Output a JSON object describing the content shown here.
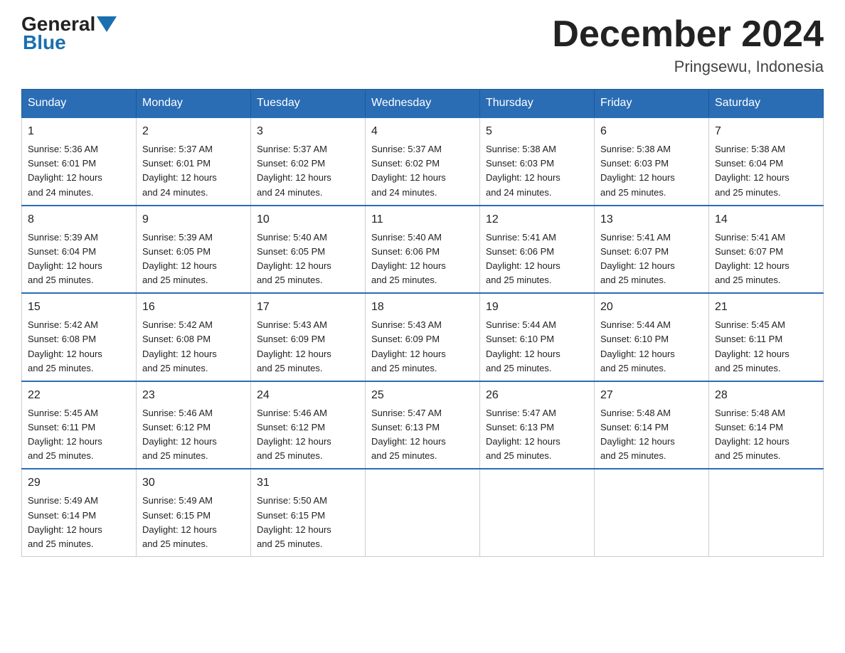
{
  "logo": {
    "general": "General",
    "blue": "Blue"
  },
  "title": {
    "month": "December 2024",
    "location": "Pringsewu, Indonesia"
  },
  "header": {
    "days": [
      "Sunday",
      "Monday",
      "Tuesday",
      "Wednesday",
      "Thursday",
      "Friday",
      "Saturday"
    ]
  },
  "weeks": [
    [
      {
        "day": "1",
        "sunrise": "5:36 AM",
        "sunset": "6:01 PM",
        "daylight": "12 hours and 24 minutes."
      },
      {
        "day": "2",
        "sunrise": "5:37 AM",
        "sunset": "6:01 PM",
        "daylight": "12 hours and 24 minutes."
      },
      {
        "day": "3",
        "sunrise": "5:37 AM",
        "sunset": "6:02 PM",
        "daylight": "12 hours and 24 minutes."
      },
      {
        "day": "4",
        "sunrise": "5:37 AM",
        "sunset": "6:02 PM",
        "daylight": "12 hours and 24 minutes."
      },
      {
        "day": "5",
        "sunrise": "5:38 AM",
        "sunset": "6:03 PM",
        "daylight": "12 hours and 24 minutes."
      },
      {
        "day": "6",
        "sunrise": "5:38 AM",
        "sunset": "6:03 PM",
        "daylight": "12 hours and 25 minutes."
      },
      {
        "day": "7",
        "sunrise": "5:38 AM",
        "sunset": "6:04 PM",
        "daylight": "12 hours and 25 minutes."
      }
    ],
    [
      {
        "day": "8",
        "sunrise": "5:39 AM",
        "sunset": "6:04 PM",
        "daylight": "12 hours and 25 minutes."
      },
      {
        "day": "9",
        "sunrise": "5:39 AM",
        "sunset": "6:05 PM",
        "daylight": "12 hours and 25 minutes."
      },
      {
        "day": "10",
        "sunrise": "5:40 AM",
        "sunset": "6:05 PM",
        "daylight": "12 hours and 25 minutes."
      },
      {
        "day": "11",
        "sunrise": "5:40 AM",
        "sunset": "6:06 PM",
        "daylight": "12 hours and 25 minutes."
      },
      {
        "day": "12",
        "sunrise": "5:41 AM",
        "sunset": "6:06 PM",
        "daylight": "12 hours and 25 minutes."
      },
      {
        "day": "13",
        "sunrise": "5:41 AM",
        "sunset": "6:07 PM",
        "daylight": "12 hours and 25 minutes."
      },
      {
        "day": "14",
        "sunrise": "5:41 AM",
        "sunset": "6:07 PM",
        "daylight": "12 hours and 25 minutes."
      }
    ],
    [
      {
        "day": "15",
        "sunrise": "5:42 AM",
        "sunset": "6:08 PM",
        "daylight": "12 hours and 25 minutes."
      },
      {
        "day": "16",
        "sunrise": "5:42 AM",
        "sunset": "6:08 PM",
        "daylight": "12 hours and 25 minutes."
      },
      {
        "day": "17",
        "sunrise": "5:43 AM",
        "sunset": "6:09 PM",
        "daylight": "12 hours and 25 minutes."
      },
      {
        "day": "18",
        "sunrise": "5:43 AM",
        "sunset": "6:09 PM",
        "daylight": "12 hours and 25 minutes."
      },
      {
        "day": "19",
        "sunrise": "5:44 AM",
        "sunset": "6:10 PM",
        "daylight": "12 hours and 25 minutes."
      },
      {
        "day": "20",
        "sunrise": "5:44 AM",
        "sunset": "6:10 PM",
        "daylight": "12 hours and 25 minutes."
      },
      {
        "day": "21",
        "sunrise": "5:45 AM",
        "sunset": "6:11 PM",
        "daylight": "12 hours and 25 minutes."
      }
    ],
    [
      {
        "day": "22",
        "sunrise": "5:45 AM",
        "sunset": "6:11 PM",
        "daylight": "12 hours and 25 minutes."
      },
      {
        "day": "23",
        "sunrise": "5:46 AM",
        "sunset": "6:12 PM",
        "daylight": "12 hours and 25 minutes."
      },
      {
        "day": "24",
        "sunrise": "5:46 AM",
        "sunset": "6:12 PM",
        "daylight": "12 hours and 25 minutes."
      },
      {
        "day": "25",
        "sunrise": "5:47 AM",
        "sunset": "6:13 PM",
        "daylight": "12 hours and 25 minutes."
      },
      {
        "day": "26",
        "sunrise": "5:47 AM",
        "sunset": "6:13 PM",
        "daylight": "12 hours and 25 minutes."
      },
      {
        "day": "27",
        "sunrise": "5:48 AM",
        "sunset": "6:14 PM",
        "daylight": "12 hours and 25 minutes."
      },
      {
        "day": "28",
        "sunrise": "5:48 AM",
        "sunset": "6:14 PM",
        "daylight": "12 hours and 25 minutes."
      }
    ],
    [
      {
        "day": "29",
        "sunrise": "5:49 AM",
        "sunset": "6:14 PM",
        "daylight": "12 hours and 25 minutes."
      },
      {
        "day": "30",
        "sunrise": "5:49 AM",
        "sunset": "6:15 PM",
        "daylight": "12 hours and 25 minutes."
      },
      {
        "day": "31",
        "sunrise": "5:50 AM",
        "sunset": "6:15 PM",
        "daylight": "12 hours and 25 minutes."
      },
      null,
      null,
      null,
      null
    ]
  ],
  "labels": {
    "sunrise": "Sunrise:",
    "sunset": "Sunset:",
    "daylight": "Daylight:"
  }
}
